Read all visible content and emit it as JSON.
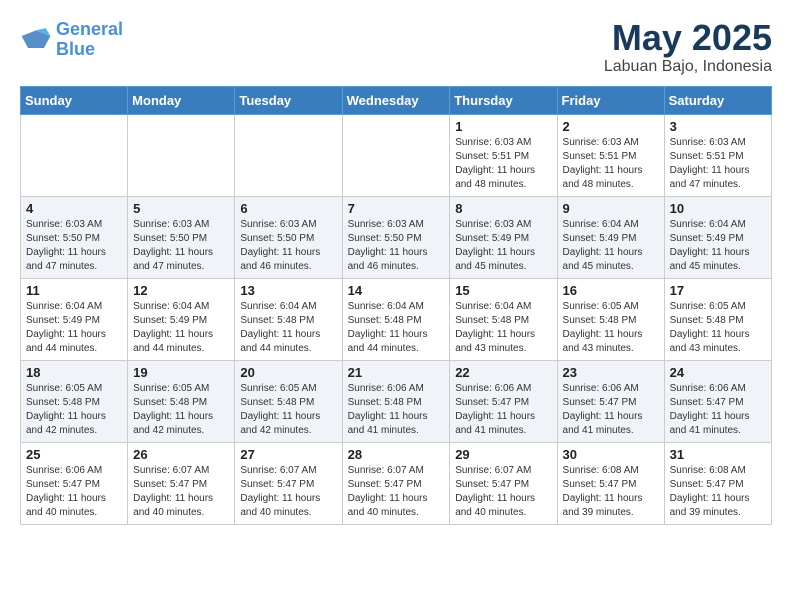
{
  "header": {
    "logo_line1": "General",
    "logo_line2": "Blue",
    "month_title": "May 2025",
    "subtitle": "Labuan Bajo, Indonesia"
  },
  "days_of_week": [
    "Sunday",
    "Monday",
    "Tuesday",
    "Wednesday",
    "Thursday",
    "Friday",
    "Saturday"
  ],
  "weeks": [
    [
      {
        "day": "",
        "info": ""
      },
      {
        "day": "",
        "info": ""
      },
      {
        "day": "",
        "info": ""
      },
      {
        "day": "",
        "info": ""
      },
      {
        "day": "1",
        "info": "Sunrise: 6:03 AM\nSunset: 5:51 PM\nDaylight: 11 hours\nand 48 minutes."
      },
      {
        "day": "2",
        "info": "Sunrise: 6:03 AM\nSunset: 5:51 PM\nDaylight: 11 hours\nand 48 minutes."
      },
      {
        "day": "3",
        "info": "Sunrise: 6:03 AM\nSunset: 5:51 PM\nDaylight: 11 hours\nand 47 minutes."
      }
    ],
    [
      {
        "day": "4",
        "info": "Sunrise: 6:03 AM\nSunset: 5:50 PM\nDaylight: 11 hours\nand 47 minutes."
      },
      {
        "day": "5",
        "info": "Sunrise: 6:03 AM\nSunset: 5:50 PM\nDaylight: 11 hours\nand 47 minutes."
      },
      {
        "day": "6",
        "info": "Sunrise: 6:03 AM\nSunset: 5:50 PM\nDaylight: 11 hours\nand 46 minutes."
      },
      {
        "day": "7",
        "info": "Sunrise: 6:03 AM\nSunset: 5:50 PM\nDaylight: 11 hours\nand 46 minutes."
      },
      {
        "day": "8",
        "info": "Sunrise: 6:03 AM\nSunset: 5:49 PM\nDaylight: 11 hours\nand 45 minutes."
      },
      {
        "day": "9",
        "info": "Sunrise: 6:04 AM\nSunset: 5:49 PM\nDaylight: 11 hours\nand 45 minutes."
      },
      {
        "day": "10",
        "info": "Sunrise: 6:04 AM\nSunset: 5:49 PM\nDaylight: 11 hours\nand 45 minutes."
      }
    ],
    [
      {
        "day": "11",
        "info": "Sunrise: 6:04 AM\nSunset: 5:49 PM\nDaylight: 11 hours\nand 44 minutes."
      },
      {
        "day": "12",
        "info": "Sunrise: 6:04 AM\nSunset: 5:49 PM\nDaylight: 11 hours\nand 44 minutes."
      },
      {
        "day": "13",
        "info": "Sunrise: 6:04 AM\nSunset: 5:48 PM\nDaylight: 11 hours\nand 44 minutes."
      },
      {
        "day": "14",
        "info": "Sunrise: 6:04 AM\nSunset: 5:48 PM\nDaylight: 11 hours\nand 44 minutes."
      },
      {
        "day": "15",
        "info": "Sunrise: 6:04 AM\nSunset: 5:48 PM\nDaylight: 11 hours\nand 43 minutes."
      },
      {
        "day": "16",
        "info": "Sunrise: 6:05 AM\nSunset: 5:48 PM\nDaylight: 11 hours\nand 43 minutes."
      },
      {
        "day": "17",
        "info": "Sunrise: 6:05 AM\nSunset: 5:48 PM\nDaylight: 11 hours\nand 43 minutes."
      }
    ],
    [
      {
        "day": "18",
        "info": "Sunrise: 6:05 AM\nSunset: 5:48 PM\nDaylight: 11 hours\nand 42 minutes."
      },
      {
        "day": "19",
        "info": "Sunrise: 6:05 AM\nSunset: 5:48 PM\nDaylight: 11 hours\nand 42 minutes."
      },
      {
        "day": "20",
        "info": "Sunrise: 6:05 AM\nSunset: 5:48 PM\nDaylight: 11 hours\nand 42 minutes."
      },
      {
        "day": "21",
        "info": "Sunrise: 6:06 AM\nSunset: 5:48 PM\nDaylight: 11 hours\nand 41 minutes."
      },
      {
        "day": "22",
        "info": "Sunrise: 6:06 AM\nSunset: 5:47 PM\nDaylight: 11 hours\nand 41 minutes."
      },
      {
        "day": "23",
        "info": "Sunrise: 6:06 AM\nSunset: 5:47 PM\nDaylight: 11 hours\nand 41 minutes."
      },
      {
        "day": "24",
        "info": "Sunrise: 6:06 AM\nSunset: 5:47 PM\nDaylight: 11 hours\nand 41 minutes."
      }
    ],
    [
      {
        "day": "25",
        "info": "Sunrise: 6:06 AM\nSunset: 5:47 PM\nDaylight: 11 hours\nand 40 minutes."
      },
      {
        "day": "26",
        "info": "Sunrise: 6:07 AM\nSunset: 5:47 PM\nDaylight: 11 hours\nand 40 minutes."
      },
      {
        "day": "27",
        "info": "Sunrise: 6:07 AM\nSunset: 5:47 PM\nDaylight: 11 hours\nand 40 minutes."
      },
      {
        "day": "28",
        "info": "Sunrise: 6:07 AM\nSunset: 5:47 PM\nDaylight: 11 hours\nand 40 minutes."
      },
      {
        "day": "29",
        "info": "Sunrise: 6:07 AM\nSunset: 5:47 PM\nDaylight: 11 hours\nand 40 minutes."
      },
      {
        "day": "30",
        "info": "Sunrise: 6:08 AM\nSunset: 5:47 PM\nDaylight: 11 hours\nand 39 minutes."
      },
      {
        "day": "31",
        "info": "Sunrise: 6:08 AM\nSunset: 5:47 PM\nDaylight: 11 hours\nand 39 minutes."
      }
    ]
  ]
}
